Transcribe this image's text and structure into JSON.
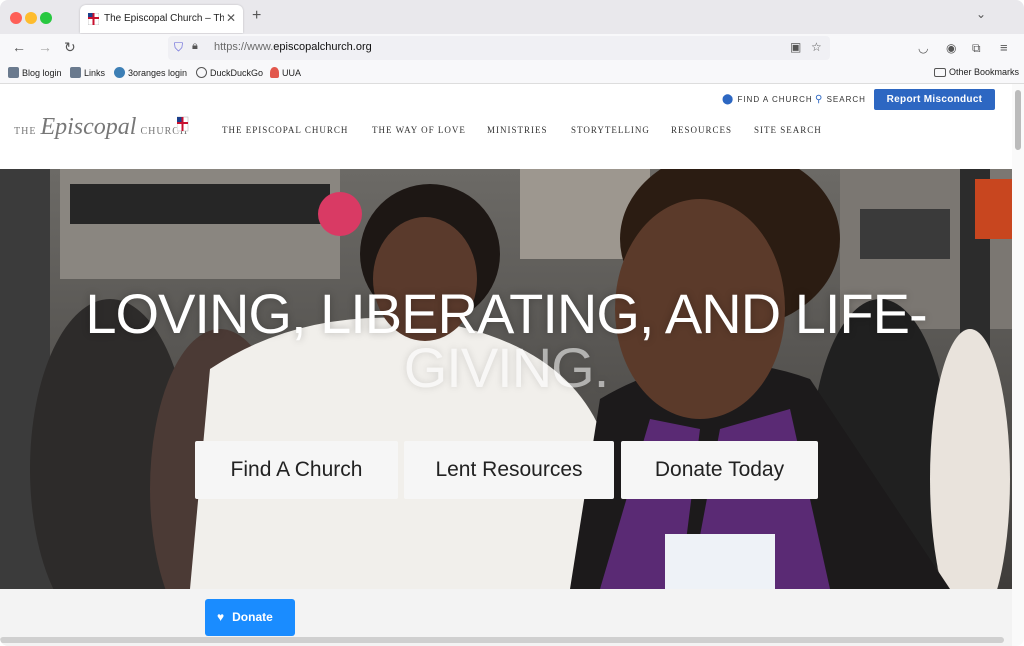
{
  "browser": {
    "tab_title": "The Episcopal Church – The Ep",
    "tab_close": "✕",
    "new_tab": "+",
    "url_prefix": "https://www.",
    "url_domain": "episcopalchurch.org",
    "bookmarks": [
      {
        "label": "Blog login",
        "icon": "avatar-icon"
      },
      {
        "label": "Links",
        "icon": "avatar-icon"
      },
      {
        "label": "3oranges login",
        "icon": "wordpress-icon"
      },
      {
        "label": "DuckDuckGo",
        "icon": "globe-icon"
      },
      {
        "label": "UUA",
        "icon": "chalice-icon"
      }
    ],
    "other_bookmarks": "Other Bookmarks"
  },
  "site": {
    "logo": {
      "the": "THE",
      "episcopal": "Episcopal",
      "church": "CHURCH"
    },
    "utility": {
      "find": "FIND A CHURCH",
      "search": "SEARCH",
      "misconduct": "Report Misconduct"
    },
    "nav": [
      "THE EPISCOPAL CHURCH",
      "THE WAY OF LOVE",
      "MINISTRIES",
      "STORYTELLING",
      "RESOURCES",
      "SITE SEARCH"
    ],
    "hero": {
      "headline_1": "LOVING, LIBERATING, AND LIFE-",
      "headline_2": "GIVING.",
      "buttons": [
        "Find A Church",
        "Lent Resources",
        "Donate Today"
      ]
    },
    "donate": "Donate"
  },
  "colors": {
    "accent": "#2d67c2",
    "donate": "#1a8cff"
  }
}
